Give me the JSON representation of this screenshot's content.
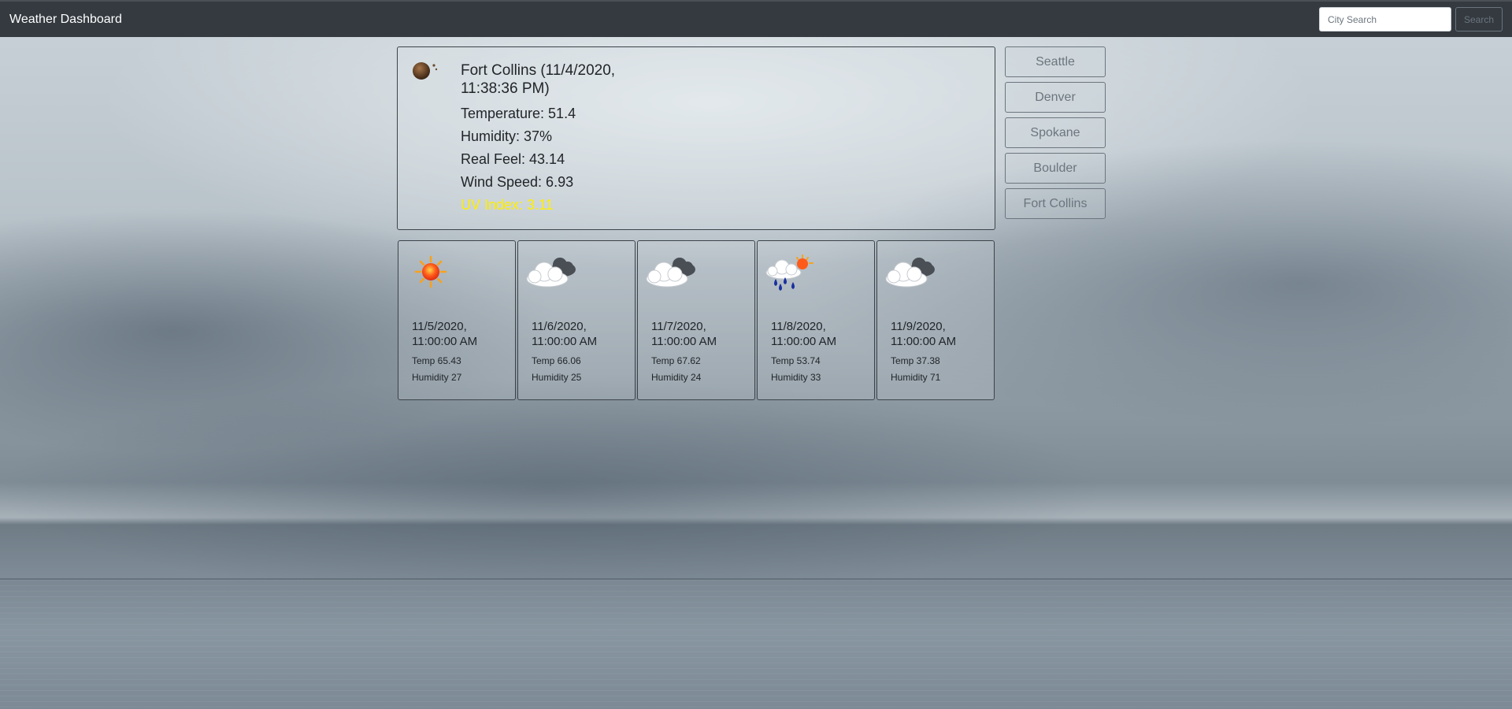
{
  "navbar": {
    "brand": "Weather Dashboard",
    "search_placeholder": "City Search",
    "search_button": "Search"
  },
  "current": {
    "title": "Fort Collins (11/4/2020, 11:38:36 PM)",
    "temperature": "Temperature: 51.4",
    "humidity": "Humidity: 37%",
    "real_feel": "Real Feel: 43.14",
    "wind_speed": "Wind Speed: 6.93",
    "uv_index": "UV Index: 3.11",
    "icon": "night-clear-moon-icon",
    "uv_color": "#ffee00"
  },
  "history": [
    "Seattle",
    "Denver",
    "Spokane",
    "Boulder",
    "Fort Collins"
  ],
  "forecast": [
    {
      "date": "11/5/2020, 11:00:00 AM",
      "temp": "Temp 65.43",
      "humidity": "Humidity 27",
      "icon": "sun-icon"
    },
    {
      "date": "11/6/2020, 11:00:00 AM",
      "temp": "Temp 66.06",
      "humidity": "Humidity 25",
      "icon": "cloudy-icon"
    },
    {
      "date": "11/7/2020, 11:00:00 AM",
      "temp": "Temp 67.62",
      "humidity": "Humidity 24",
      "icon": "cloudy-icon"
    },
    {
      "date": "11/8/2020, 11:00:00 AM",
      "temp": "Temp 53.74",
      "humidity": "Humidity 33",
      "icon": "rain-sun-icon"
    },
    {
      "date": "11/9/2020, 11:00:00 AM",
      "temp": "Temp 37.38",
      "humidity": "Humidity 71",
      "icon": "cloudy-icon"
    }
  ]
}
